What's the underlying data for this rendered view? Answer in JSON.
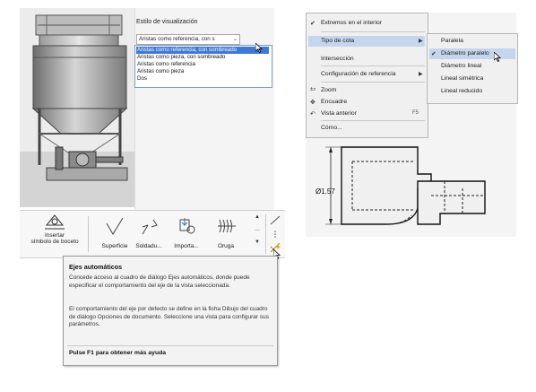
{
  "style_panel": {
    "title": "Estilo de visualización",
    "selected": "Aristas como referencia, con s",
    "options": [
      "Aristas como referencia, con sombreado",
      "Aristas como pieza, con sombreado",
      "Aristas como referencia",
      "Aristas como pieza",
      "Dos"
    ]
  },
  "ribbon": {
    "insert_symbol": [
      "Insertar",
      "símbolo de boceto"
    ],
    "buttons": [
      "Superficie",
      "Soldadu...",
      "Importa...",
      "Oruga"
    ]
  },
  "tooltip": {
    "title": "Ejes automáticos",
    "p1": "Concede acceso al cuadro de diálogo Ejes automáticos, donde puede especificar el comportamiento del eje de la vista seleccionada.",
    "p2": "El comportamiento del eje por defecto se define en la ficha Dibujo del cuadro de diálogo Opciones de documento. Seleccione una vista para configurar sus parámetros.",
    "footer": "Pulse F1 para obtener más ayuda"
  },
  "context_menu": {
    "items": [
      {
        "label": "Extremos en el interior",
        "checked": true
      },
      {
        "label": "Tipo de cota",
        "submenu": true,
        "highlighted": true
      },
      {
        "label": "Intersección"
      },
      {
        "label": "Configuración de referencia",
        "submenu": true
      },
      {
        "label": "Zoom"
      },
      {
        "label": "Encuadre"
      },
      {
        "label": "Vista anterior",
        "shortcut": "F5"
      },
      {
        "label": "Cómo..."
      }
    ]
  },
  "sub_menu": {
    "items": [
      {
        "label": "Paralela"
      },
      {
        "label": "Diámetro paralelo",
        "checked": true,
        "highlighted": true
      },
      {
        "label": "Diámetro lineal"
      },
      {
        "label": "Lineal simétrica"
      },
      {
        "label": "Lineal reducido"
      }
    ]
  },
  "drawing": {
    "dimension": "Ø1.57"
  },
  "icons": {
    "insert_symbol": "sketch-symbol-icon",
    "surface": "surface-symbol-icon",
    "weld": "weld-symbol-icon",
    "import": "import-symbol-icon",
    "caterpillar": "caterpillar-icon",
    "axis_auto": "auto-axis-icon",
    "check": "check-icon",
    "submenu_arrow": "chevron-right-icon"
  },
  "colors": {
    "selection_blue": "#3d7ad6",
    "menu_highlight": "#c4d6ee",
    "tooltip_bg": "#f3f3f3"
  }
}
